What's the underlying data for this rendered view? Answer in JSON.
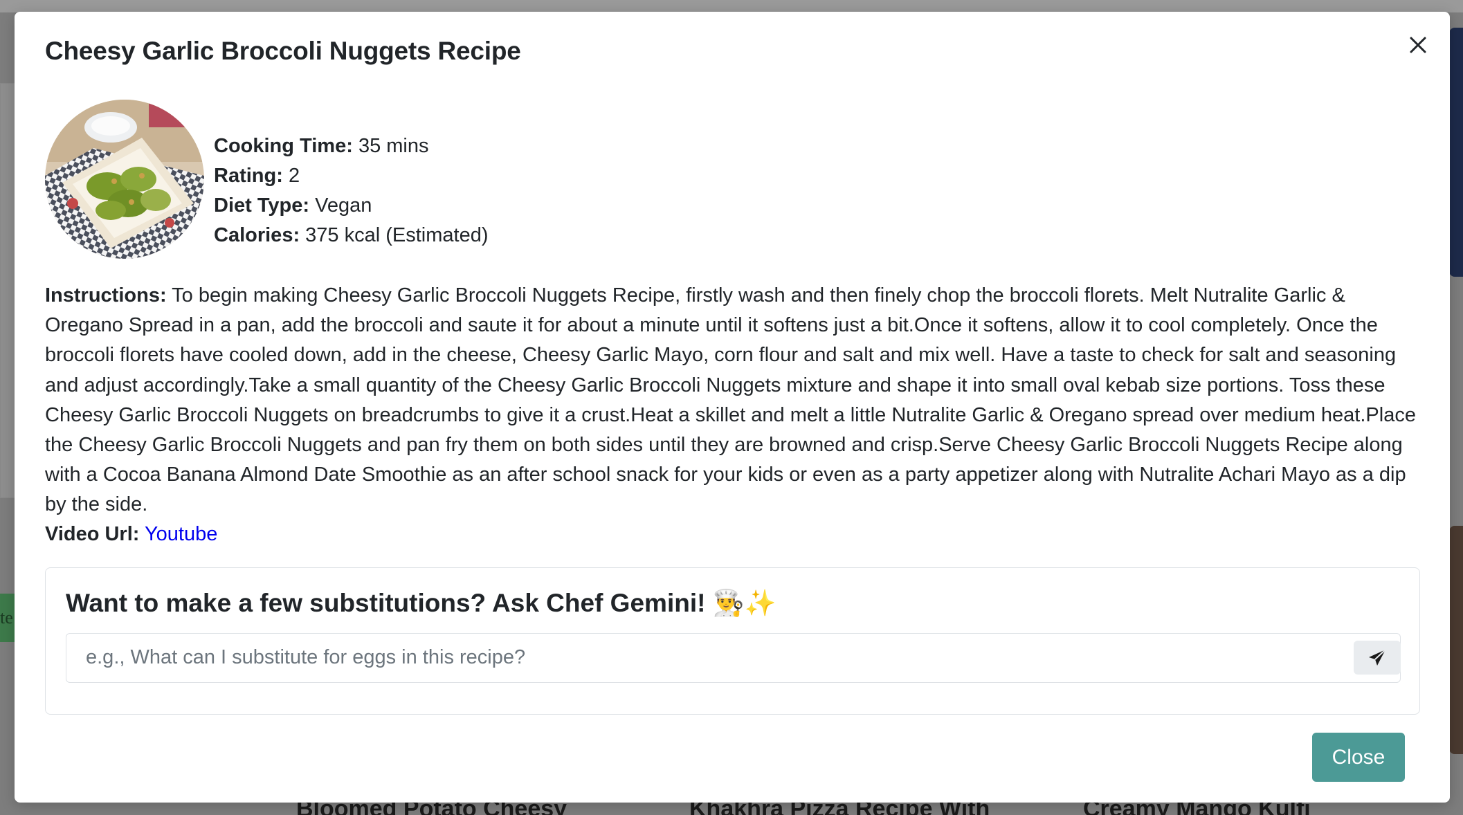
{
  "modal": {
    "title": "Cheesy Garlic Broccoli Nuggets Recipe",
    "close_icon": "close-icon",
    "image_alt": "broccoli-nuggets-photo"
  },
  "meta": {
    "cooking_time_label": "Cooking Time:",
    "cooking_time_value": "35 mins",
    "rating_label": "Rating:",
    "rating_value": "2",
    "diet_label": "Diet Type:",
    "diet_value": "Vegan",
    "calories_label": "Calories:",
    "calories_value": "375 kcal (Estimated)"
  },
  "instructions": {
    "label": "Instructions:",
    "text": "To begin making Cheesy Garlic Broccoli Nuggets Recipe, firstly wash and then finely chop the broccoli florets. Melt Nutralite Garlic & Oregano Spread in a pan, add the broccoli and saute it for about a minute until it softens just a bit.Once it softens, allow it to cool completely. Once the broccoli florets have cooled down, add in the cheese, Cheesy Garlic Mayo, corn flour and salt and mix well. Have a taste to check for salt and seasoning and adjust accordingly.Take a small quantity of the Cheesy Garlic Broccoli Nuggets mixture and shape it into small oval kebab size portions. Toss these Cheesy Garlic Broccoli Nuggets on breadcrumbs to give it a crust.Heat a skillet and melt a little Nutralite Garlic & Oregano spread over medium heat.Place the Cheesy Garlic Broccoli Nuggets and pan fry them on both sides until they are browned and crisp.Serve Cheesy Garlic Broccoli Nuggets Recipe along with a Cocoa Banana Almond Date Smoothie as an after school snack for your kids or even as a party appetizer along with Nutralite Achari Mayo as a dip by the side."
  },
  "video": {
    "label": "Video Url:",
    "link_text": "Youtube"
  },
  "ask": {
    "title": "Want to make a few substitutions? Ask Chef Gemini! 👨‍🍳✨",
    "placeholder": "e.g., What can I substitute for eggs in this recipe?",
    "value": "",
    "send_icon": "send-icon"
  },
  "footer": {
    "close_label": "Close"
  },
  "background": {
    "left_button_text": "te",
    "card_titles": [
      "Bloomed Potato Cheesy",
      "Khakhra Pizza Recipe With",
      "Creamy Mango Kulfi"
    ]
  },
  "colors": {
    "accent": "#4c9a96",
    "link": "#0000ee",
    "text": "#212529",
    "placeholder": "#6c757d"
  }
}
